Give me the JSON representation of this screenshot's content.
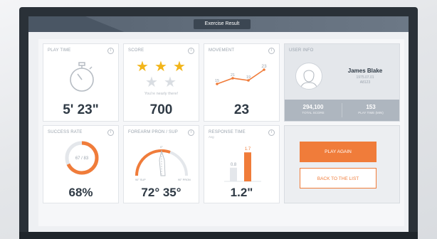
{
  "header": {
    "title": "Exercise Result"
  },
  "cards": {
    "play_time": {
      "title": "PLAY TIME",
      "value": "5' 23\""
    },
    "score": {
      "title": "SCORE",
      "stars_filled": 3,
      "stars_total": 5,
      "message": "You're nearly there!",
      "value": "700"
    },
    "movement": {
      "title": "MOVEMENT",
      "points": [
        "15",
        "21",
        "19",
        "23"
      ],
      "value": "23"
    },
    "success_rate": {
      "title": "SUCCESS RATE",
      "ratio": "67 / 83",
      "value": "68%",
      "fraction": 0.68
    },
    "forearm": {
      "title": "FOREARM PRON / SUP",
      "value": "72° 35°",
      "left_label": "90°\nSUP",
      "right_label": "90°\nPRON",
      "top_label": "0°"
    },
    "response_time": {
      "title": "RESPONSE TIME",
      "subtitle": "Avg",
      "bars": [
        {
          "label": "0.8",
          "value": 0.8
        },
        {
          "label": "1.7",
          "value": 1.7
        }
      ],
      "value": "1.2\""
    }
  },
  "user_info": {
    "title": "USER INFO",
    "name": "James Blake",
    "dob": "1975.07.01",
    "id": "A8123",
    "total_score": {
      "value": "294,100",
      "label": "TOTAL SCORE"
    },
    "play_time": {
      "value": "153",
      "label": "PLAY TIME (MIN)"
    }
  },
  "actions": {
    "play_again": "PLAY AGAIN",
    "back": "BACK TO THE LIST"
  },
  "colors": {
    "accent": "#f07c3a",
    "frame": "#2a3138",
    "text": "#2f3a45"
  },
  "icons": {
    "info": "info-icon",
    "stopwatch": "stopwatch-icon",
    "star": "star-icon",
    "avatar": "avatar-icon"
  }
}
